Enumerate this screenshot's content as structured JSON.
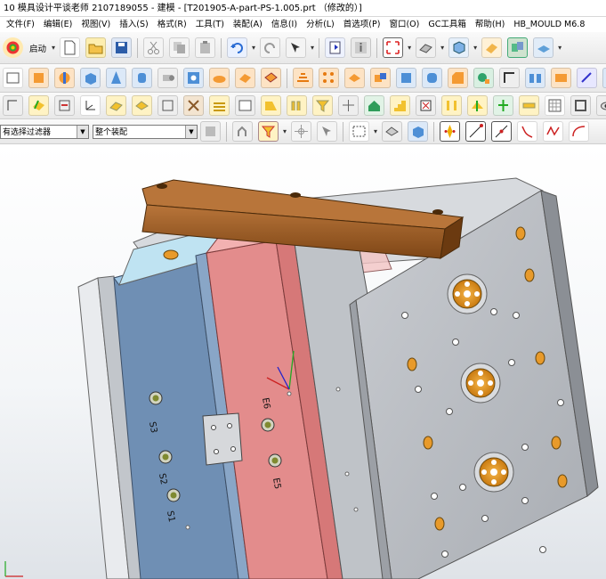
{
  "window": {
    "title": "10  模具设计平谈老师  2107189055 - 建模 - [T201905-A-part-PS-1.005.prt （修改的）]"
  },
  "menu": {
    "items": [
      "文件(F)",
      "编辑(E)",
      "视图(V)",
      "插入(S)",
      "格式(R)",
      "工具(T)",
      "装配(A)",
      "信息(I)",
      "分析(L)",
      "首选项(P)",
      "窗口(O)",
      "GC工具箱",
      "帮助(H)",
      "HB_MOULD M6.8"
    ]
  },
  "toolbar": {
    "start_label": "启动",
    "selection_filter": "有选择过滤器",
    "assembly_scope": "整个装配"
  },
  "viewport": {
    "plate_labels": {
      "s3": "S3",
      "s2": "S2",
      "s1": "S1",
      "e6": "E6",
      "e5": "E5"
    },
    "colors": {
      "clamp_bar": "#9a5a22",
      "blue_plate": "#6f8fb4",
      "pink_plate": "#e38c8c",
      "grey_plate": "#bfc3c8",
      "orange_parts": "#e89a2a"
    }
  }
}
